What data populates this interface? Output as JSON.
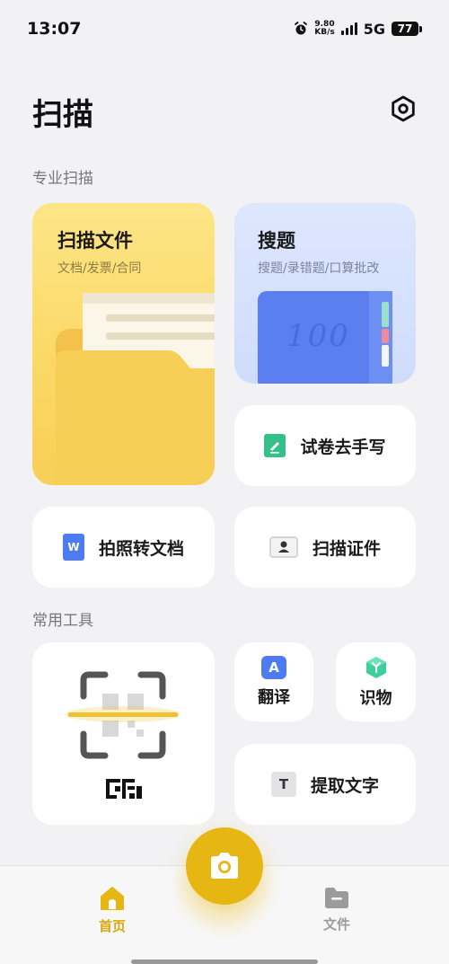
{
  "status": {
    "time": "13:07",
    "net_speed_value": "9.80",
    "net_speed_unit": "KB/s",
    "network": "5G",
    "battery": "77"
  },
  "header": {
    "title": "扫描"
  },
  "sections": {
    "pro": "专业扫描",
    "tools": "常用工具"
  },
  "cards": {
    "scan_file": {
      "title": "扫描文件",
      "subtitle": "文档/发票/合同"
    },
    "search_question": {
      "title": "搜题",
      "subtitle": "搜题/录错题/口算批改",
      "book_text": "100"
    },
    "exam": {
      "label": "试卷去手写"
    },
    "photo_doc": {
      "label": "拍照转文档",
      "icon_letter": "W"
    },
    "id_card": {
      "label": "扫描证件"
    },
    "translate": {
      "label": "翻译",
      "icon_letter": "A"
    },
    "identify": {
      "label": "识物"
    },
    "extract_text": {
      "label": "提取文字",
      "icon_letter": "T"
    }
  },
  "tabbar": {
    "home_label": "首页",
    "files_label": "文件"
  },
  "colors": {
    "accent": "#e6b612",
    "home_active": "#d9a90f",
    "inactive": "#9b9b9b"
  }
}
